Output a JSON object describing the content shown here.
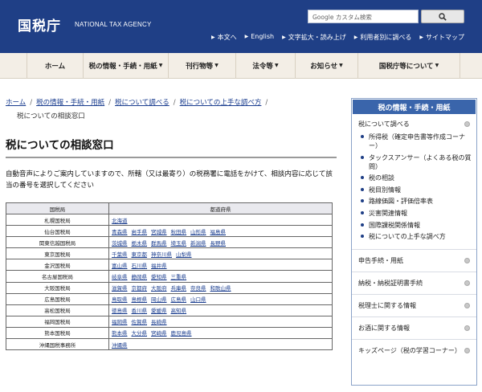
{
  "header": {
    "logo_jp": "国税庁",
    "logo_en": "NATIONAL TAX AGENCY",
    "search_placeholder": "Google カスタム検索",
    "util_links": [
      "本文へ",
      "English",
      "文字拡大・読み上げ",
      "利用者別に調べる",
      "サイトマップ"
    ]
  },
  "gnav": [
    {
      "label": "ホーム",
      "caret": false
    },
    {
      "label": "税の情報・手続・用紙",
      "caret": true
    },
    {
      "label": "刊行物等",
      "caret": true
    },
    {
      "label": "法令等",
      "caret": true
    },
    {
      "label": "お知らせ",
      "caret": true
    },
    {
      "label": "国税庁等について",
      "caret": true
    }
  ],
  "breadcrumb": {
    "links": [
      "ホーム",
      "税の情報・手続・用紙",
      "税について調べる",
      "税についての上手な調べ方"
    ],
    "current": "税についての相談窓口"
  },
  "page_title": "税についての相談窓口",
  "intro": "自動音声によりご案内していますので、所轄（又は最寄り）の税務署に電話をかけて、相談内容に応じて該当の番号を選択してください",
  "table": {
    "headers": [
      "国税局",
      "都道府県"
    ],
    "rows": [
      {
        "bureau": "札幌国税局",
        "prefs": [
          "北海道"
        ]
      },
      {
        "bureau": "仙台国税局",
        "prefs": [
          "青森県",
          "岩手県",
          "宮城県",
          "秋田県",
          "山形県",
          "福島県"
        ]
      },
      {
        "bureau": "関東信越国税局",
        "prefs": [
          "茨城県",
          "栃木県",
          "群馬県",
          "埼玉県",
          "新潟県",
          "長野県"
        ]
      },
      {
        "bureau": "東京国税局",
        "prefs": [
          "千葉県",
          "東京都",
          "神奈川県",
          "山梨県"
        ]
      },
      {
        "bureau": "金沢国税局",
        "prefs": [
          "富山県",
          "石川県",
          "福井県"
        ]
      },
      {
        "bureau": "名古屋国税局",
        "prefs": [
          "岐阜県",
          "静岡県",
          "愛知県",
          "三重県"
        ]
      },
      {
        "bureau": "大阪国税局",
        "prefs": [
          "滋賀県",
          "京都府",
          "大阪府",
          "兵庫県",
          "奈良県",
          "和歌山県"
        ]
      },
      {
        "bureau": "広島国税局",
        "prefs": [
          "鳥取県",
          "島根県",
          "岡山県",
          "広島県",
          "山口県"
        ]
      },
      {
        "bureau": "高松国税局",
        "prefs": [
          "徳島県",
          "香川県",
          "愛媛県",
          "高知県"
        ]
      },
      {
        "bureau": "福岡国税局",
        "prefs": [
          "福岡県",
          "佐賀県",
          "長崎県"
        ]
      },
      {
        "bureau": "熊本国税局",
        "prefs": [
          "熊本県",
          "大分県",
          "宮崎県",
          "鹿児島県"
        ]
      },
      {
        "bureau": "沖縄国税事務所",
        "prefs": [
          "沖縄県"
        ]
      }
    ]
  },
  "sidebar": {
    "title": "税の情報・手続・用紙",
    "top_item": "税について調べる",
    "sub_items": [
      "所得税（確定申告書等作成コーナー）",
      "タックスアンサー（よくある税の質問）",
      "税の相談",
      "税目別情報",
      "路線価図・評価倍率表",
      "災害関連情報",
      "国際課税関係情報",
      "税についての上手な調べ方"
    ],
    "sections": [
      "申告手続・用紙",
      "納税・納税証明書手続",
      "税理士に関する情報",
      "お酒に関する情報",
      "キッズページ（税の学習コーナー）"
    ]
  }
}
